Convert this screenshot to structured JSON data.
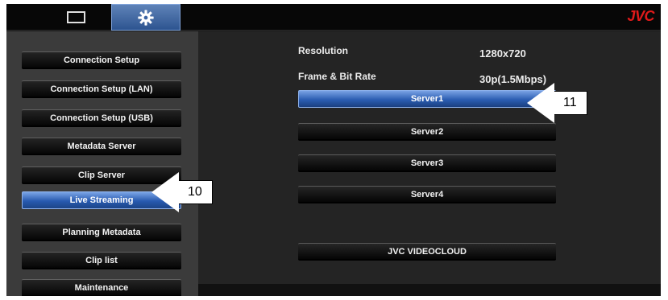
{
  "topbar": {
    "tabs": [
      {
        "name": "monitor",
        "icon": "monitor-icon"
      },
      {
        "name": "settings",
        "icon": "gear-icon",
        "active": true
      }
    ],
    "logo": "JVC",
    "logo_color": "#e01a1a"
  },
  "sidebar": {
    "items": [
      {
        "label": "Connection Setup"
      },
      {
        "label": "Connection Setup (LAN)"
      },
      {
        "label": "Connection Setup (USB)"
      },
      {
        "label": "Metadata Server"
      },
      {
        "label": "Clip Server"
      },
      {
        "label": "Live Streaming",
        "active": true
      },
      {
        "label": "Planning Metadata"
      },
      {
        "label": "Clip list"
      },
      {
        "label": "Maintenance"
      }
    ]
  },
  "main": {
    "resolution_label": "Resolution",
    "resolution_value": "1280x720",
    "framerate_label": "Frame & Bit Rate",
    "framerate_value": "30p(1.5Mbps)",
    "servers": [
      {
        "label": "Server1",
        "active": true
      },
      {
        "label": "Server2"
      },
      {
        "label": "Server3"
      },
      {
        "label": "Server4"
      }
    ],
    "cloud_button": "JVC VIDEOCLOUD"
  },
  "callouts": [
    {
      "number": "10"
    },
    {
      "number": "11"
    }
  ],
  "colors": {
    "accent_active": "#2b5db2",
    "background": "#242424"
  }
}
